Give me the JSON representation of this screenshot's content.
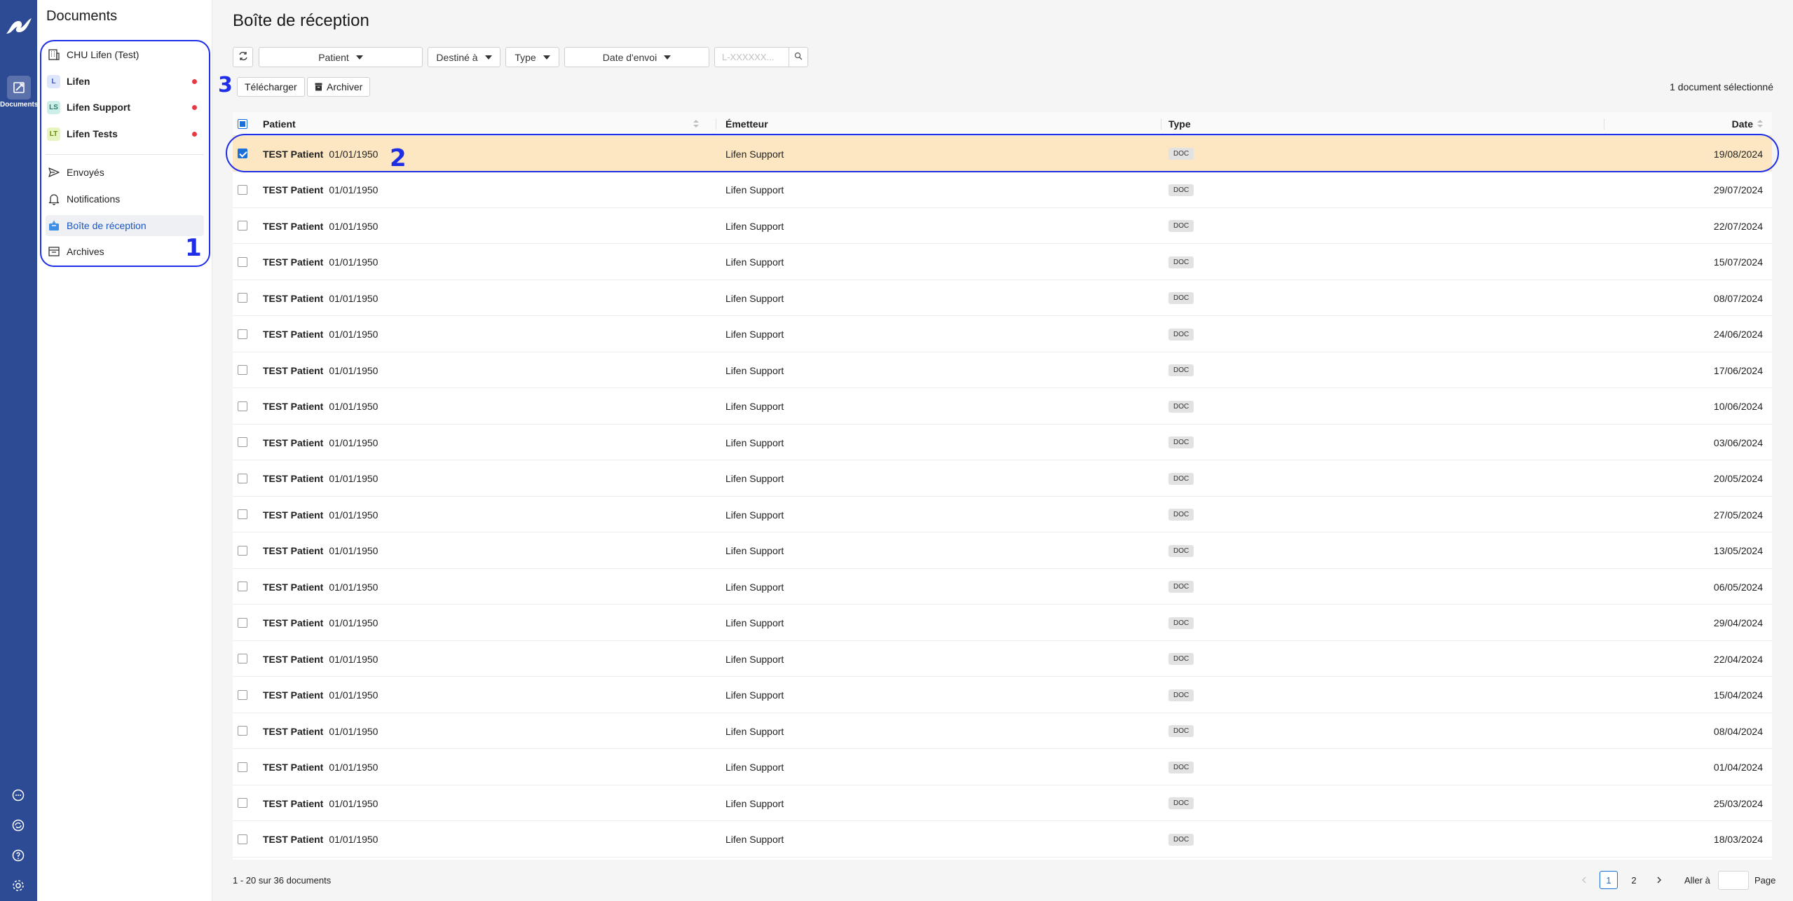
{
  "rail": {
    "documents_label": "Documents"
  },
  "sidebar": {
    "title": "Documents",
    "items": [
      {
        "label": "CHU Lifen (Test)"
      },
      {
        "label": "Lifen",
        "avatar": "L",
        "avatar_bg": "#dde6fb",
        "avatar_color": "#3a55b8"
      },
      {
        "label": "Lifen Support",
        "avatar": "LS",
        "avatar_bg": "#cdeee9",
        "avatar_color": "#2a7f72"
      },
      {
        "label": "Lifen Tests",
        "avatar": "LT",
        "avatar_bg": "#e6f4bf",
        "avatar_color": "#6d8a12"
      },
      {
        "label": "Envoyés"
      },
      {
        "label": "Notifications"
      },
      {
        "label": "Boîte de réception"
      },
      {
        "label": "Archives"
      }
    ]
  },
  "annotations": {
    "one": "1",
    "two": "2",
    "three": "3"
  },
  "main": {
    "title": "Boîte de réception",
    "filters": {
      "patient": "Patient",
      "destine": "Destiné à",
      "type": "Type",
      "date": "Date d'envoi",
      "search_placeholder": "L-XXXXXX..."
    },
    "actions": {
      "download": "Télécharger",
      "archive": "Archiver",
      "selected_count": "1 document sélectionné"
    },
    "table": {
      "headers": {
        "patient": "Patient",
        "emetteur": "Émetteur",
        "type": "Type",
        "date": "Date"
      },
      "rows": [
        {
          "name": "TEST Patient",
          "dob": "01/01/1950",
          "sender": "Lifen Support",
          "type": "DOC",
          "date": "19/08/2024",
          "selected": true
        },
        {
          "name": "TEST Patient",
          "dob": "01/01/1950",
          "sender": "Lifen Support",
          "type": "DOC",
          "date": "29/07/2024"
        },
        {
          "name": "TEST Patient",
          "dob": "01/01/1950",
          "sender": "Lifen Support",
          "type": "DOC",
          "date": "22/07/2024"
        },
        {
          "name": "TEST Patient",
          "dob": "01/01/1950",
          "sender": "Lifen Support",
          "type": "DOC",
          "date": "15/07/2024"
        },
        {
          "name": "TEST Patient",
          "dob": "01/01/1950",
          "sender": "Lifen Support",
          "type": "DOC",
          "date": "08/07/2024"
        },
        {
          "name": "TEST Patient",
          "dob": "01/01/1950",
          "sender": "Lifen Support",
          "type": "DOC",
          "date": "24/06/2024"
        },
        {
          "name": "TEST Patient",
          "dob": "01/01/1950",
          "sender": "Lifen Support",
          "type": "DOC",
          "date": "17/06/2024"
        },
        {
          "name": "TEST Patient",
          "dob": "01/01/1950",
          "sender": "Lifen Support",
          "type": "DOC",
          "date": "10/06/2024"
        },
        {
          "name": "TEST Patient",
          "dob": "01/01/1950",
          "sender": "Lifen Support",
          "type": "DOC",
          "date": "03/06/2024"
        },
        {
          "name": "TEST Patient",
          "dob": "01/01/1950",
          "sender": "Lifen Support",
          "type": "DOC",
          "date": "20/05/2024"
        },
        {
          "name": "TEST Patient",
          "dob": "01/01/1950",
          "sender": "Lifen Support",
          "type": "DOC",
          "date": "27/05/2024"
        },
        {
          "name": "TEST Patient",
          "dob": "01/01/1950",
          "sender": "Lifen Support",
          "type": "DOC",
          "date": "13/05/2024"
        },
        {
          "name": "TEST Patient",
          "dob": "01/01/1950",
          "sender": "Lifen Support",
          "type": "DOC",
          "date": "06/05/2024"
        },
        {
          "name": "TEST Patient",
          "dob": "01/01/1950",
          "sender": "Lifen Support",
          "type": "DOC",
          "date": "29/04/2024"
        },
        {
          "name": "TEST Patient",
          "dob": "01/01/1950",
          "sender": "Lifen Support",
          "type": "DOC",
          "date": "22/04/2024"
        },
        {
          "name": "TEST Patient",
          "dob": "01/01/1950",
          "sender": "Lifen Support",
          "type": "DOC",
          "date": "15/04/2024"
        },
        {
          "name": "TEST Patient",
          "dob": "01/01/1950",
          "sender": "Lifen Support",
          "type": "DOC",
          "date": "08/04/2024"
        },
        {
          "name": "TEST Patient",
          "dob": "01/01/1950",
          "sender": "Lifen Support",
          "type": "DOC",
          "date": "01/04/2024"
        },
        {
          "name": "TEST Patient",
          "dob": "01/01/1950",
          "sender": "Lifen Support",
          "type": "DOC",
          "date": "25/03/2024"
        },
        {
          "name": "TEST Patient",
          "dob": "01/01/1950",
          "sender": "Lifen Support",
          "type": "DOC",
          "date": "18/03/2024"
        }
      ]
    },
    "footer": {
      "count": "1 - 20 sur 36 documents",
      "pages": [
        "1",
        "2"
      ],
      "goto_label": "Aller à",
      "page_label": "Page"
    }
  },
  "colors": {
    "rail": "#2d4a94",
    "accent": "#1a6fd8",
    "selected_row": "#fde7c3",
    "annotation": "#1e2ee6",
    "notification_dot": "#e63946"
  }
}
